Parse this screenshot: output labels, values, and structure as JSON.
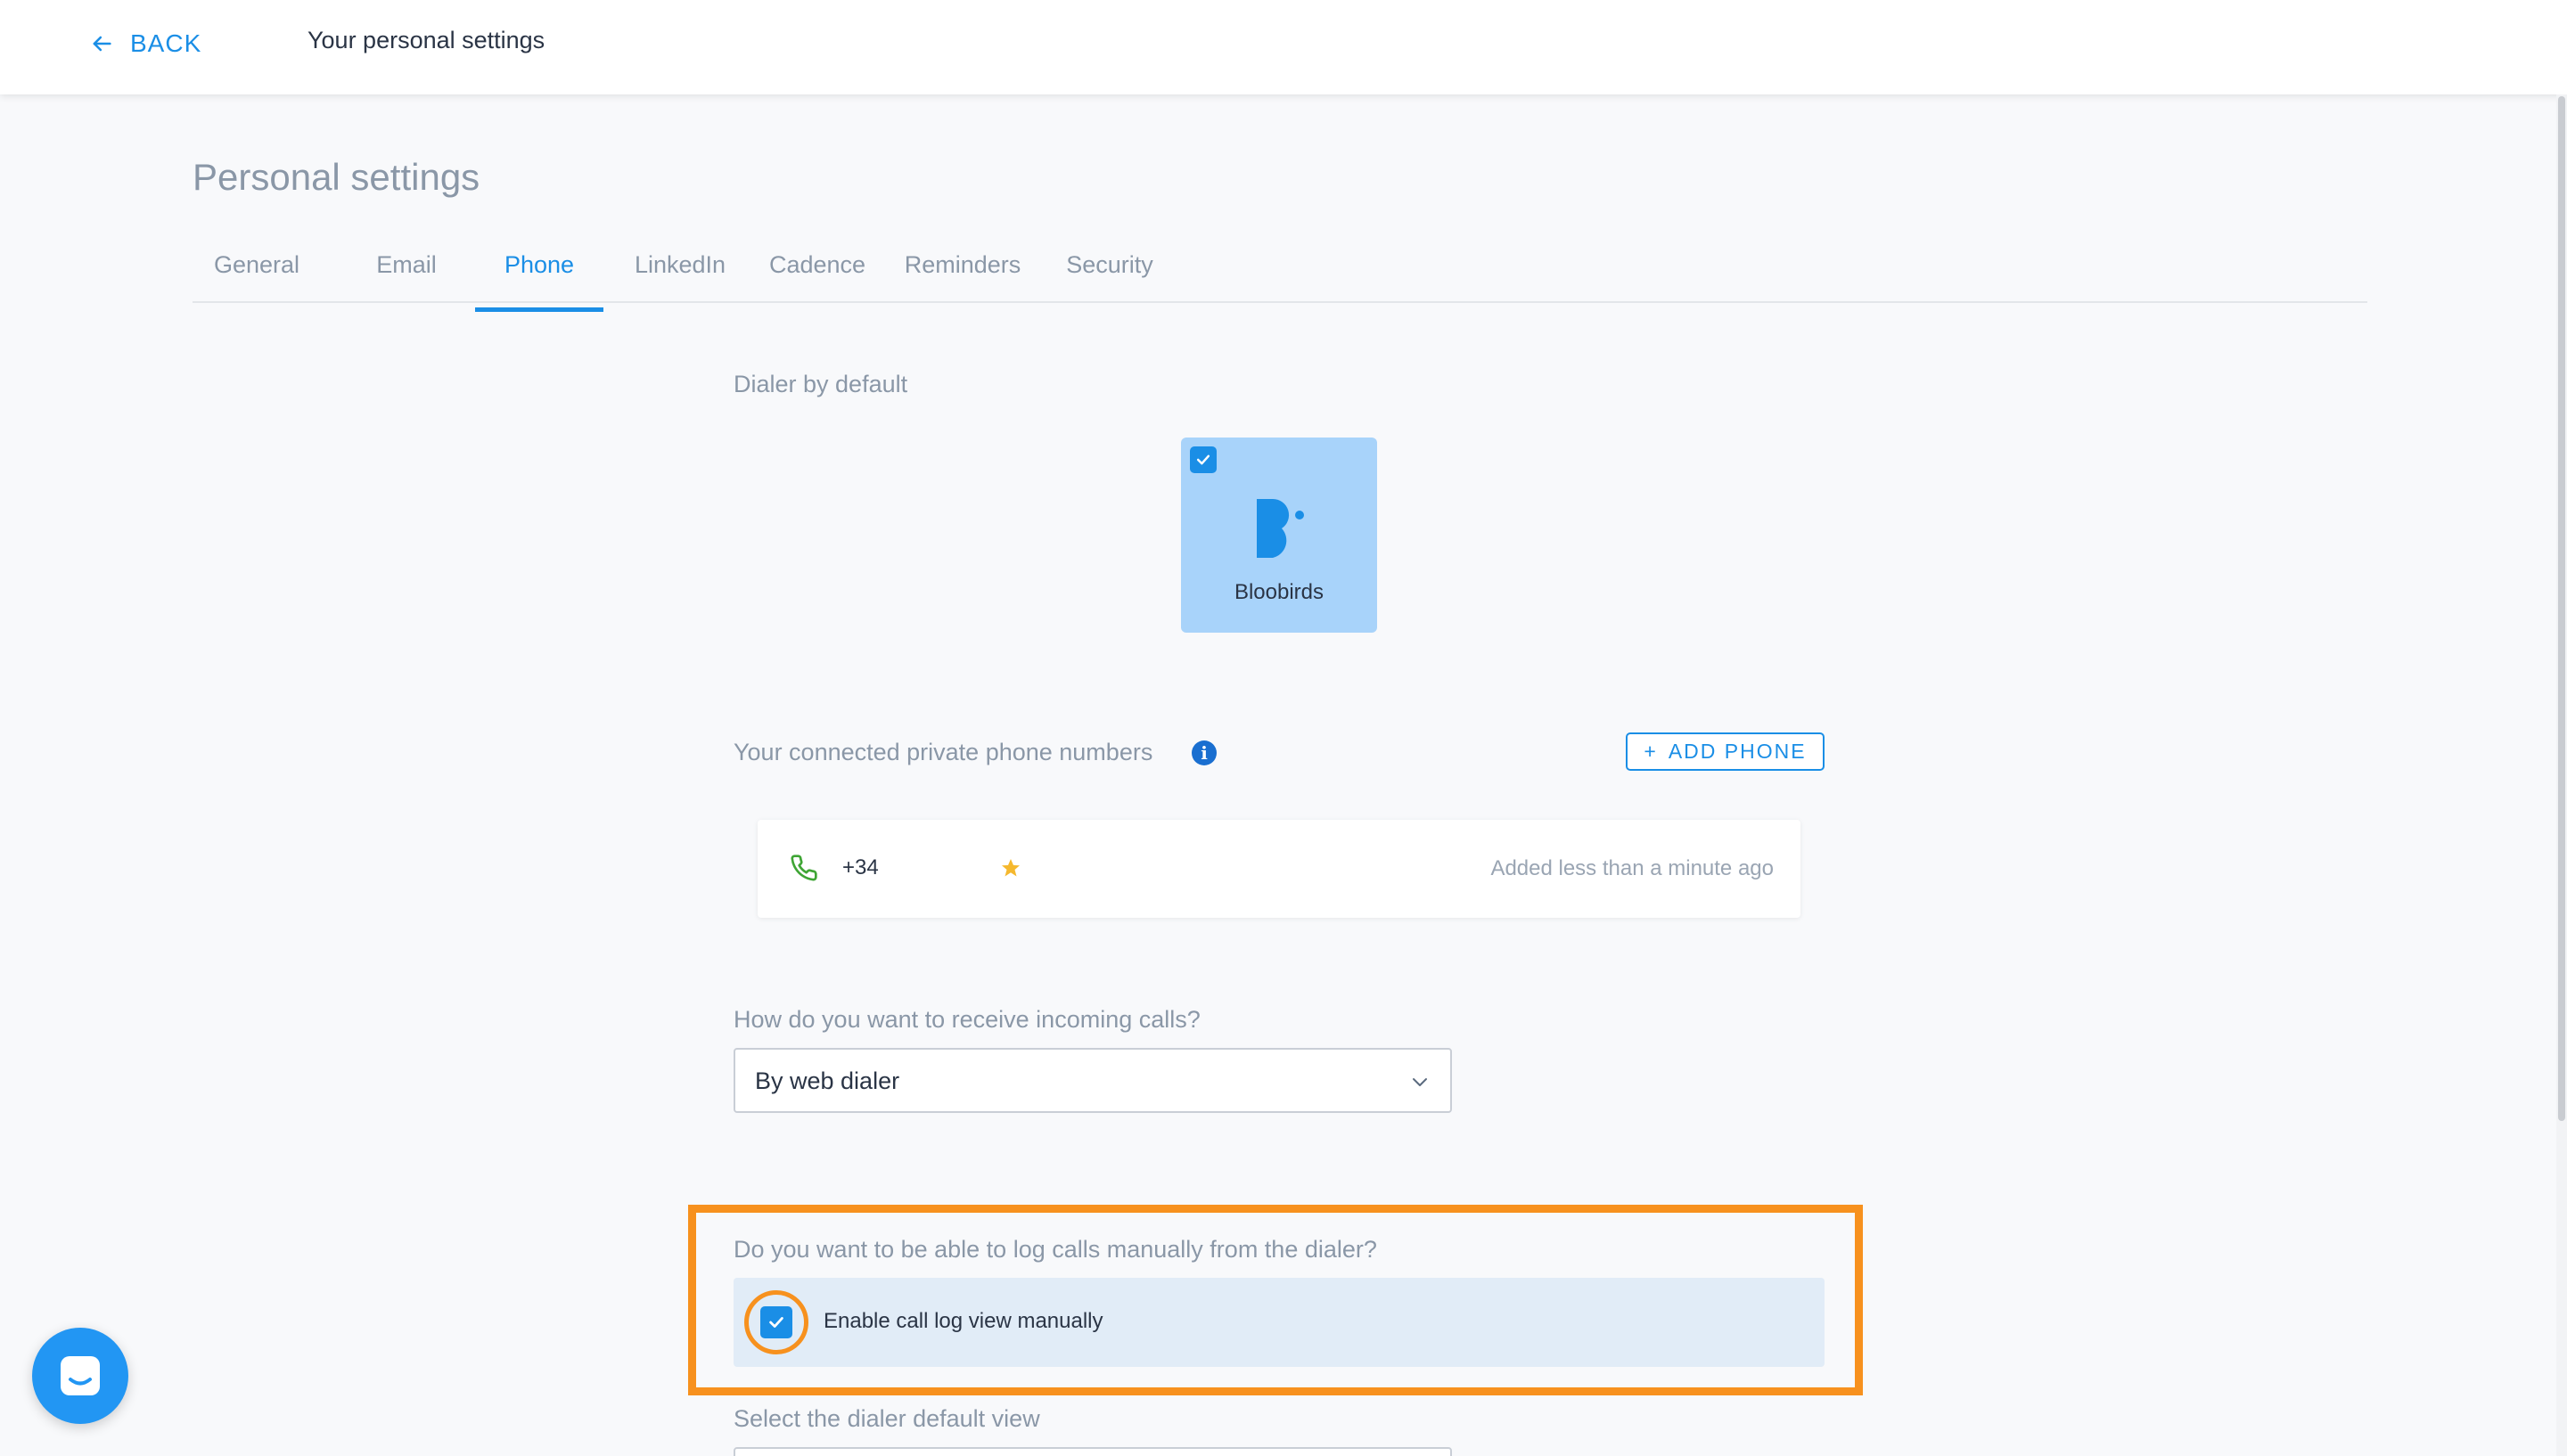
{
  "header": {
    "back_label": "BACK",
    "title": "Your personal settings"
  },
  "page": {
    "title": "Personal settings"
  },
  "tabs": [
    {
      "label": "General"
    },
    {
      "label": "Email"
    },
    {
      "label": "Phone"
    },
    {
      "label": "LinkedIn"
    },
    {
      "label": "Cadence"
    },
    {
      "label": "Reminders"
    },
    {
      "label": "Security"
    }
  ],
  "active_tab": "Phone",
  "dialer": {
    "section_label": "Dialer by default",
    "selected_name": "Bloobirds",
    "selected": true
  },
  "phones": {
    "section_label": "Your connected private phone numbers",
    "info_icon": "i",
    "add_button_icon": "+",
    "add_button_label": "ADD PHONE",
    "items": [
      {
        "number": "+34",
        "added": "Added less than a minute ago",
        "favorite": true
      }
    ]
  },
  "incoming": {
    "question": "How do you want to receive incoming calls?",
    "value": "By web dialer"
  },
  "call_log": {
    "question": "Do you want to be able to log calls manually from the dialer?",
    "checkbox_label": "Enable call log view manually",
    "checked": true
  },
  "default_view": {
    "label": "Select the dialer default view"
  },
  "colors": {
    "accent": "#1a8ee6",
    "highlight": "#f7911e",
    "dialer_card": "#a8d3fa",
    "phone_icon": "#3fa535",
    "star": "#f5b82e"
  }
}
